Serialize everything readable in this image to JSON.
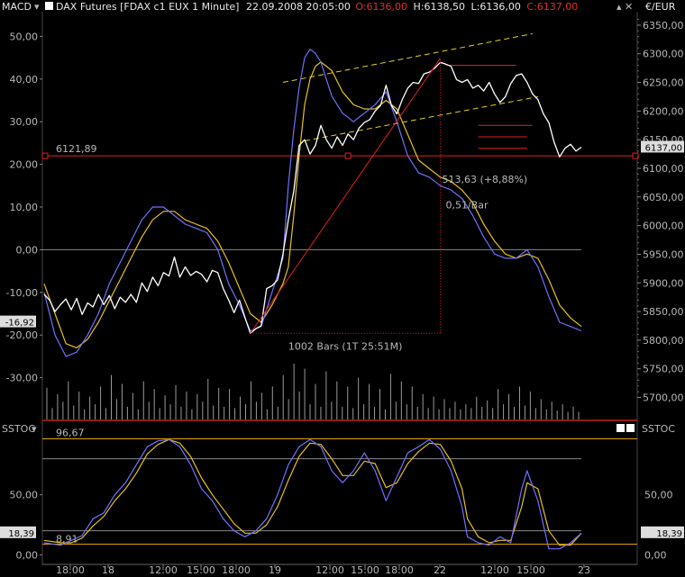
{
  "header": {
    "macd_label": "MACD",
    "title": "DAX Futures [FDAX c1 EUX  1 Minute]",
    "datetime": "22.09.2008 20:05:00",
    "open": "O:6136,00",
    "high": "H:6138,50",
    "low": "L:6136,00",
    "close": "C:6137,00",
    "currency": "€/EUR"
  },
  "macd_axis": {
    "ticks": [
      "50,00",
      "40,00",
      "30,00",
      "20,00",
      "10,00",
      "0,00",
      "-10,00",
      "-20,00",
      "-30,00"
    ],
    "current": "-16,92"
  },
  "price_axis": {
    "ticks": [
      "6350,00",
      "6300,00",
      "6250,00",
      "6200,00",
      "6150,00",
      "6100,00",
      "6050,00",
      "6000,00",
      "5950,00",
      "5900,00",
      "5850,00",
      "5800,00",
      "5750,00",
      "5700,00"
    ],
    "current": "6137,00"
  },
  "annotations": {
    "hline_label": "6121,89",
    "change_label": "513,63 (+8,88%)",
    "rate_label": "0,51/Bar",
    "bars_label": "1002 Bars (1T 25:51M)"
  },
  "stoch": {
    "label_left": "SSTOC",
    "label_right": "SSTOC",
    "upper_level": "96,67",
    "lower_level": "8,91",
    "ticks": [
      "50,00",
      "0,00"
    ],
    "current": "18,39"
  },
  "time_axis": {
    "labels": [
      "18:00",
      "18",
      "12:00",
      "15:00",
      "18:00",
      "19",
      "12:00",
      "15:00",
      "18:00",
      "22",
      "12:00",
      "15:00",
      "23"
    ]
  },
  "colors": {
    "price": "#ffffff",
    "macd": "#7070ff",
    "signal": "#e8c020",
    "hline": "#e02020",
    "channel": "#e8d020"
  },
  "chart_data": [
    {
      "type": "line",
      "title": "DAX Futures [FDAX c1 EUX  1 Minute]",
      "price_series_xy": [
        [
          0,
          5880
        ],
        [
          2,
          5870
        ],
        [
          4,
          5850
        ],
        [
          6,
          5862
        ],
        [
          8,
          5872
        ],
        [
          10,
          5853
        ],
        [
          12,
          5873
        ],
        [
          14,
          5845
        ],
        [
          16,
          5865
        ],
        [
          18,
          5858
        ],
        [
          20,
          5880
        ],
        [
          22,
          5862
        ],
        [
          24,
          5878
        ],
        [
          26,
          5855
        ],
        [
          28,
          5875
        ],
        [
          30,
          5866
        ],
        [
          32,
          5880
        ],
        [
          34,
          5866
        ],
        [
          36,
          5900
        ],
        [
          38,
          5885
        ],
        [
          40,
          5910
        ],
        [
          42,
          5895
        ],
        [
          44,
          5918
        ],
        [
          46,
          5912
        ],
        [
          48,
          5945
        ],
        [
          50,
          5910
        ],
        [
          52,
          5928
        ],
        [
          54,
          5913
        ],
        [
          56,
          5920
        ],
        [
          58,
          5915
        ],
        [
          60,
          5902
        ],
        [
          62,
          5922
        ],
        [
          64,
          5918
        ],
        [
          66,
          5890
        ],
        [
          68,
          5870
        ],
        [
          70,
          5848
        ],
        [
          72,
          5870
        ],
        [
          74,
          5840
        ],
        [
          76,
          5812
        ],
        [
          78,
          5820
        ],
        [
          80,
          5825
        ],
        [
          82,
          5890
        ],
        [
          84,
          5895
        ],
        [
          86,
          5905
        ],
        [
          88,
          5950
        ],
        [
          90,
          6010
        ],
        [
          92,
          6060
        ],
        [
          94,
          6140
        ],
        [
          96,
          6150
        ],
        [
          98,
          6125
        ],
        [
          100,
          6140
        ],
        [
          102,
          6175
        ],
        [
          104,
          6150
        ],
        [
          106,
          6135
        ],
        [
          108,
          6155
        ],
        [
          110,
          6140
        ],
        [
          112,
          6160
        ],
        [
          114,
          6150
        ],
        [
          116,
          6170
        ],
        [
          118,
          6180
        ],
        [
          120,
          6185
        ],
        [
          122,
          6200
        ],
        [
          124,
          6210
        ],
        [
          126,
          6245
        ],
        [
          128,
          6210
        ],
        [
          130,
          6195
        ],
        [
          132,
          6220
        ],
        [
          134,
          6240
        ],
        [
          136,
          6250
        ],
        [
          138,
          6248
        ],
        [
          140,
          6265
        ],
        [
          142,
          6268
        ],
        [
          144,
          6275
        ],
        [
          146,
          6285
        ],
        [
          148,
          6282
        ],
        [
          150,
          6278
        ],
        [
          152,
          6255
        ],
        [
          154,
          6250
        ],
        [
          156,
          6255
        ],
        [
          158,
          6240
        ],
        [
          160,
          6245
        ],
        [
          162,
          6235
        ],
        [
          164,
          6250
        ],
        [
          166,
          6230
        ],
        [
          168,
          6215
        ],
        [
          170,
          6225
        ],
        [
          172,
          6248
        ],
        [
          174,
          6262
        ],
        [
          176,
          6265
        ],
        [
          178,
          6250
        ],
        [
          180,
          6230
        ],
        [
          182,
          6220
        ],
        [
          184,
          6195
        ],
        [
          186,
          6180
        ],
        [
          188,
          6145
        ],
        [
          190,
          6120
        ],
        [
          192,
          6135
        ],
        [
          194,
          6142
        ],
        [
          196,
          6130
        ],
        [
          198,
          6137
        ]
      ],
      "macd_series_xy": [
        [
          0,
          -10
        ],
        [
          4,
          -20
        ],
        [
          8,
          -25
        ],
        [
          12,
          -24
        ],
        [
          16,
          -20
        ],
        [
          20,
          -15
        ],
        [
          24,
          -8
        ],
        [
          28,
          -3
        ],
        [
          32,
          2
        ],
        [
          36,
          7
        ],
        [
          40,
          10
        ],
        [
          44,
          10
        ],
        [
          48,
          8
        ],
        [
          52,
          6
        ],
        [
          56,
          5
        ],
        [
          60,
          4
        ],
        [
          64,
          0
        ],
        [
          68,
          -8
        ],
        [
          72,
          -13
        ],
        [
          76,
          -19
        ],
        [
          80,
          -18
        ],
        [
          84,
          -10
        ],
        [
          88,
          -2
        ],
        [
          90,
          15
        ],
        [
          92,
          28
        ],
        [
          94,
          38
        ],
        [
          96,
          45
        ],
        [
          98,
          47
        ],
        [
          100,
          46
        ],
        [
          102,
          44
        ],
        [
          106,
          36
        ],
        [
          110,
          32
        ],
        [
          114,
          30
        ],
        [
          118,
          32
        ],
        [
          122,
          34
        ],
        [
          126,
          37
        ],
        [
          130,
          30
        ],
        [
          134,
          22
        ],
        [
          138,
          18
        ],
        [
          142,
          17
        ],
        [
          146,
          15
        ],
        [
          150,
          14
        ],
        [
          154,
          12
        ],
        [
          158,
          8
        ],
        [
          162,
          3
        ],
        [
          166,
          -1
        ],
        [
          170,
          -2
        ],
        [
          174,
          -2
        ],
        [
          178,
          0
        ],
        [
          182,
          -4
        ],
        [
          186,
          -11
        ],
        [
          190,
          -17
        ],
        [
          194,
          -18
        ],
        [
          198,
          -19
        ]
      ],
      "signal_series_xy": [
        [
          0,
          -8
        ],
        [
          4,
          -15
        ],
        [
          8,
          -22
        ],
        [
          12,
          -23
        ],
        [
          16,
          -21
        ],
        [
          20,
          -17
        ],
        [
          24,
          -12
        ],
        [
          28,
          -7
        ],
        [
          32,
          -2
        ],
        [
          36,
          3
        ],
        [
          40,
          7
        ],
        [
          44,
          9
        ],
        [
          48,
          9
        ],
        [
          52,
          7
        ],
        [
          56,
          6
        ],
        [
          60,
          5
        ],
        [
          64,
          2
        ],
        [
          68,
          -3
        ],
        [
          72,
          -9
        ],
        [
          76,
          -15
        ],
        [
          80,
          -17
        ],
        [
          84,
          -13
        ],
        [
          88,
          -8
        ],
        [
          90,
          -4
        ],
        [
          92,
          8
        ],
        [
          94,
          22
        ],
        [
          96,
          34
        ],
        [
          98,
          40
        ],
        [
          100,
          43
        ],
        [
          102,
          44
        ],
        [
          106,
          42
        ],
        [
          110,
          37
        ],
        [
          114,
          34
        ],
        [
          118,
          33
        ],
        [
          122,
          33
        ],
        [
          126,
          35
        ],
        [
          130,
          33
        ],
        [
          134,
          27
        ],
        [
          138,
          21
        ],
        [
          142,
          19
        ],
        [
          146,
          17
        ],
        [
          150,
          16
        ],
        [
          154,
          14
        ],
        [
          158,
          11
        ],
        [
          162,
          6
        ],
        [
          166,
          2
        ],
        [
          170,
          -1
        ],
        [
          174,
          -2
        ],
        [
          178,
          -1
        ],
        [
          182,
          -2
        ],
        [
          186,
          -7
        ],
        [
          190,
          -13
        ],
        [
          194,
          -16
        ],
        [
          198,
          -18
        ]
      ],
      "volume": [
        25,
        9,
        20,
        14,
        30,
        11,
        22,
        8,
        18,
        12,
        26,
        9,
        35,
        16,
        28,
        10,
        21,
        8,
        30,
        14,
        24,
        9,
        19,
        12,
        27,
        10,
        22,
        8,
        20,
        14,
        32,
        11,
        25,
        10,
        24,
        9,
        18,
        12,
        30,
        14,
        21,
        8,
        26,
        10,
        35,
        16,
        44,
        22,
        40,
        12,
        28,
        10,
        38,
        14,
        30,
        10,
        26,
        9,
        33,
        12,
        28,
        10,
        24,
        8,
        36,
        14,
        30,
        12,
        26,
        10,
        20,
        9,
        18,
        8,
        16,
        9,
        14,
        8,
        12,
        9,
        18,
        10,
        15,
        9,
        24,
        12,
        20,
        10,
        26,
        11,
        22,
        9,
        16,
        8,
        14,
        7,
        12,
        6,
        10,
        6
      ],
      "macd_ylim": [
        -40,
        56
      ],
      "price_ylim": [
        5660,
        6375
      ],
      "hlines": [
        6121.89
      ],
      "annotations": [
        "513,63 (+8,88%)",
        "0,51/Bar",
        "1002 Bars (1T 25:51M)"
      ]
    },
    {
      "type": "line",
      "title": "SSTOC",
      "k_series_xy": [
        [
          0,
          10
        ],
        [
          6,
          8
        ],
        [
          10,
          12
        ],
        [
          14,
          16
        ],
        [
          18,
          30
        ],
        [
          22,
          35
        ],
        [
          26,
          50
        ],
        [
          30,
          60
        ],
        [
          34,
          75
        ],
        [
          38,
          90
        ],
        [
          42,
          95
        ],
        [
          46,
          96
        ],
        [
          50,
          90
        ],
        [
          54,
          75
        ],
        [
          58,
          55
        ],
        [
          62,
          45
        ],
        [
          66,
          30
        ],
        [
          70,
          20
        ],
        [
          74,
          15
        ],
        [
          78,
          20
        ],
        [
          82,
          30
        ],
        [
          86,
          50
        ],
        [
          90,
          75
        ],
        [
          94,
          90
        ],
        [
          98,
          96
        ],
        [
          102,
          90
        ],
        [
          106,
          70
        ],
        [
          110,
          60
        ],
        [
          114,
          70
        ],
        [
          118,
          85
        ],
        [
          122,
          70
        ],
        [
          126,
          45
        ],
        [
          130,
          65
        ],
        [
          134,
          85
        ],
        [
          138,
          90
        ],
        [
          142,
          96
        ],
        [
          146,
          88
        ],
        [
          150,
          70
        ],
        [
          154,
          40
        ],
        [
          156,
          15
        ],
        [
          160,
          10
        ],
        [
          164,
          8
        ],
        [
          168,
          15
        ],
        [
          172,
          10
        ],
        [
          176,
          55
        ],
        [
          178,
          70
        ],
        [
          182,
          45
        ],
        [
          186,
          5
        ],
        [
          190,
          5
        ],
        [
          194,
          10
        ],
        [
          198,
          18
        ]
      ],
      "d_series_xy": [
        [
          0,
          12
        ],
        [
          6,
          10
        ],
        [
          10,
          10
        ],
        [
          14,
          14
        ],
        [
          18,
          24
        ],
        [
          22,
          32
        ],
        [
          26,
          45
        ],
        [
          30,
          55
        ],
        [
          34,
          68
        ],
        [
          38,
          84
        ],
        [
          42,
          92
        ],
        [
          46,
          96
        ],
        [
          50,
          93
        ],
        [
          54,
          82
        ],
        [
          58,
          64
        ],
        [
          62,
          50
        ],
        [
          66,
          38
        ],
        [
          70,
          26
        ],
        [
          74,
          18
        ],
        [
          78,
          18
        ],
        [
          82,
          25
        ],
        [
          86,
          40
        ],
        [
          90,
          62
        ],
        [
          94,
          82
        ],
        [
          98,
          93
        ],
        [
          102,
          92
        ],
        [
          106,
          80
        ],
        [
          110,
          66
        ],
        [
          114,
          66
        ],
        [
          118,
          78
        ],
        [
          122,
          76
        ],
        [
          126,
          56
        ],
        [
          130,
          60
        ],
        [
          134,
          76
        ],
        [
          138,
          86
        ],
        [
          142,
          93
        ],
        [
          146,
          92
        ],
        [
          150,
          78
        ],
        [
          154,
          55
        ],
        [
          156,
          30
        ],
        [
          160,
          15
        ],
        [
          164,
          10
        ],
        [
          168,
          12
        ],
        [
          172,
          12
        ],
        [
          176,
          40
        ],
        [
          178,
          60
        ],
        [
          182,
          55
        ],
        [
          186,
          20
        ],
        [
          190,
          8
        ],
        [
          194,
          8
        ],
        [
          198,
          18
        ]
      ],
      "ylim": [
        -8,
        112
      ],
      "levels": [
        96.67,
        8.91
      ]
    }
  ]
}
